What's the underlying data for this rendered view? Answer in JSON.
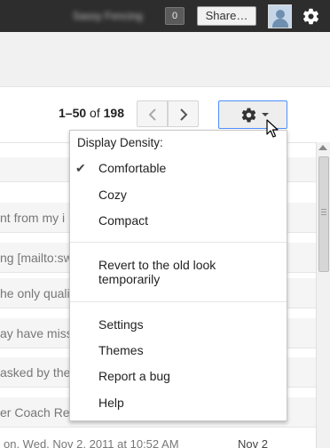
{
  "topbar": {
    "user_name": "Sassy Fencing",
    "notification_count": "0",
    "share_label": "Share…"
  },
  "toolbar": {
    "range": "1–50",
    "of": "of",
    "total": "198"
  },
  "menu": {
    "heading": "Display Density:",
    "density_options": [
      {
        "label": "Comfortable",
        "checked": true
      },
      {
        "label": "Cozy",
        "checked": false
      },
      {
        "label": "Compact",
        "checked": false
      }
    ],
    "check_mark": "✔",
    "revert_label": "Revert to the old look temporarily",
    "settings_label": "Settings",
    "themes_label": "Themes",
    "report_bug_label": "Report a bug",
    "help_label": "Help"
  },
  "mail_rows": [
    "nt from my i",
    "ng [mailto:sw",
    "he only qualif",
    "ay have miss",
    "asked by the",
    "er Coach Re"
  ],
  "partial_row": {
    "date_text": "on, Wed, Nov 2, 2011 at 10:52 AM",
    "right_text": "Nov 2"
  },
  "colors": {
    "topbar_bg": "#2d2d2d",
    "focus_border": "#4d90fe"
  }
}
